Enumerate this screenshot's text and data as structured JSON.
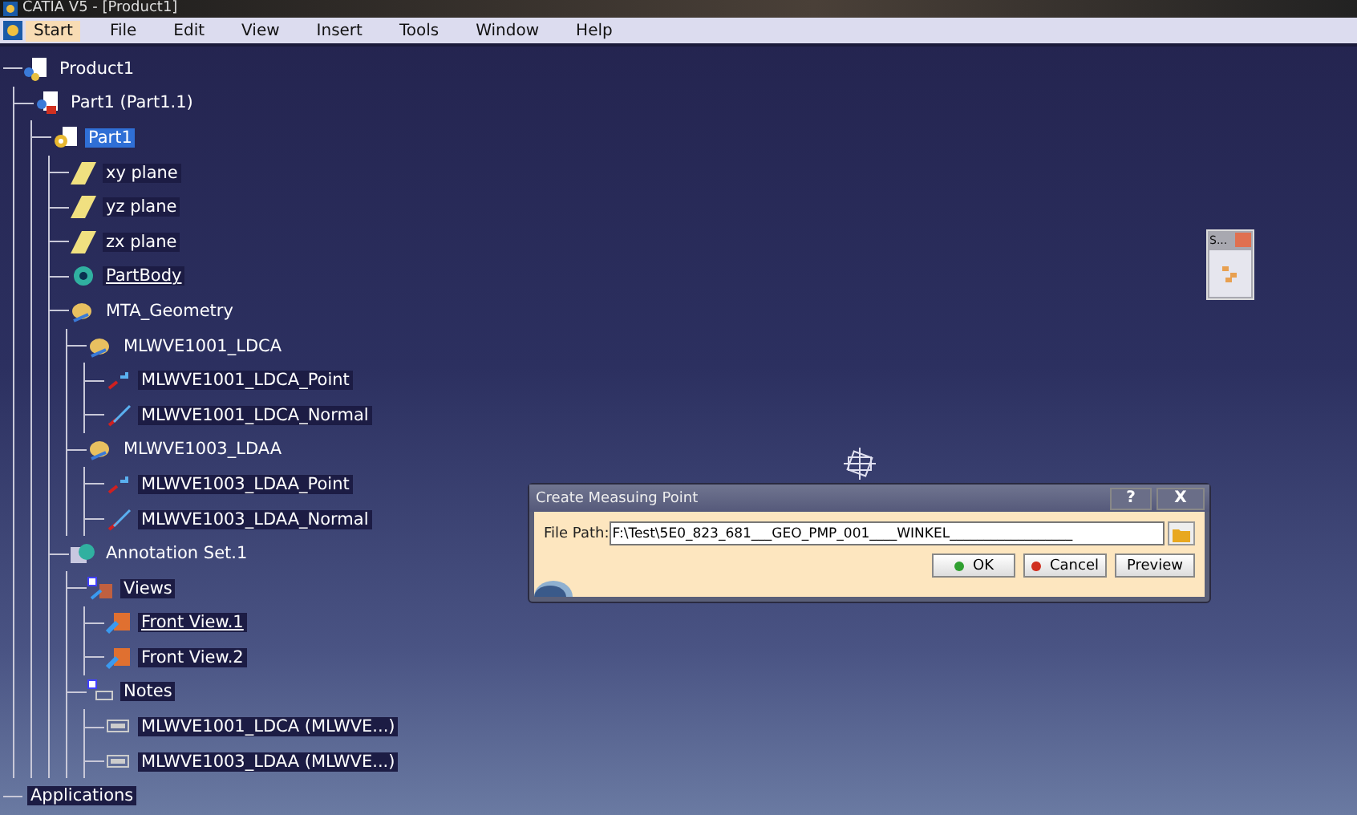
{
  "window": {
    "title": "CATIA V5 - [Product1]"
  },
  "menu": [
    {
      "label": "Start",
      "selected": true
    },
    {
      "label": "File",
      "selected": false
    },
    {
      "label": "Edit",
      "selected": false
    },
    {
      "label": "View",
      "selected": false
    },
    {
      "label": "Insert",
      "selected": false
    },
    {
      "label": "Tools",
      "selected": false
    },
    {
      "label": "Window",
      "selected": false
    },
    {
      "label": "Help",
      "selected": false
    }
  ],
  "tree": [
    {
      "label": "Product1",
      "kind": "product",
      "selected": false,
      "underlined": false,
      "children": [
        {
          "label": "Part1 (Part1.1)",
          "kind": "part",
          "selected": false,
          "underlined": false,
          "children": [
            {
              "label": "Part1",
              "kind": "partdoc",
              "selected": true,
              "underlined": false,
              "children": [
                {
                  "label": "xy plane",
                  "kind": "plane",
                  "selected": false,
                  "underlined": false
                },
                {
                  "label": "yz plane",
                  "kind": "plane",
                  "selected": false,
                  "underlined": false
                },
                {
                  "label": "zx plane",
                  "kind": "plane",
                  "selected": false,
                  "underlined": false
                },
                {
                  "label": "PartBody",
                  "kind": "body",
                  "selected": false,
                  "underlined": true
                },
                {
                  "label": "MTA_Geometry",
                  "kind": "geoset",
                  "selected": false,
                  "underlined": false,
                  "children": [
                    {
                      "label": "MLWVE1001_LDCA",
                      "kind": "geoset",
                      "selected": false,
                      "underlined": false,
                      "children": [
                        {
                          "label": "MLWVE1001_LDCA_Point",
                          "kind": "point",
                          "selected": false,
                          "underlined": false
                        },
                        {
                          "label": "MLWVE1001_LDCA_Normal",
                          "kind": "line",
                          "selected": false,
                          "underlined": false
                        }
                      ]
                    },
                    {
                      "label": "MLWVE1003_LDAA",
                      "kind": "geoset",
                      "selected": false,
                      "underlined": false,
                      "children": [
                        {
                          "label": "MLWVE1003_LDAA_Point",
                          "kind": "point",
                          "selected": false,
                          "underlined": false
                        },
                        {
                          "label": "MLWVE1003_LDAA_Normal",
                          "kind": "line",
                          "selected": false,
                          "underlined": false
                        }
                      ]
                    }
                  ]
                },
                {
                  "label": "Annotation Set.1",
                  "kind": "annotation",
                  "selected": false,
                  "underlined": false,
                  "children": [
                    {
                      "label": "Views",
                      "kind": "views",
                      "selected": false,
                      "underlined": false,
                      "children": [
                        {
                          "label": "Front View.1",
                          "kind": "view",
                          "selected": false,
                          "underlined": true
                        },
                        {
                          "label": "Front View.2",
                          "kind": "view",
                          "selected": false,
                          "underlined": false
                        }
                      ]
                    },
                    {
                      "label": "Notes",
                      "kind": "notes",
                      "selected": false,
                      "underlined": false,
                      "children": [
                        {
                          "label": "MLWVE1001_LDCA (MLWVE...)",
                          "kind": "note",
                          "selected": false,
                          "underlined": false
                        },
                        {
                          "label": "MLWVE1003_LDAA (MLWVE...)",
                          "kind": "note",
                          "selected": false,
                          "underlined": false
                        }
                      ]
                    }
                  ]
                }
              ]
            }
          ]
        }
      ]
    },
    {
      "label": "Applications",
      "kind": "none",
      "selected": false,
      "underlined": false
    }
  ],
  "palette": {
    "title": "S..."
  },
  "dialog": {
    "title": "Create Measuing Point",
    "help": "?",
    "close": "X",
    "field_label": "File Path:",
    "value": "F:\\Test\\5E0_823_681___GEO_PMP_001____WINKEL__________________",
    "buttons": [
      {
        "label": "OK",
        "kind": "ok"
      },
      {
        "label": "Cancel",
        "kind": "cancel"
      },
      {
        "label": "Preview",
        "kind": "plain"
      }
    ]
  }
}
